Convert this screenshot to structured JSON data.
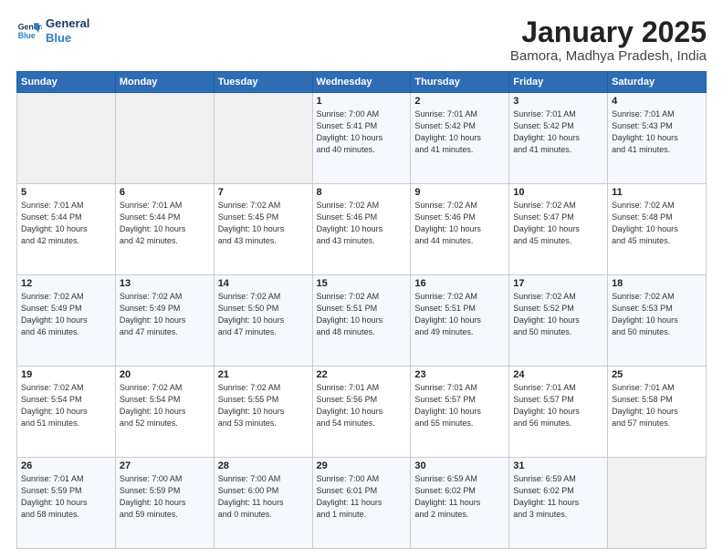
{
  "logo": {
    "line1": "General",
    "line2": "Blue"
  },
  "header": {
    "month": "January 2025",
    "location": "Bamora, Madhya Pradesh, India"
  },
  "weekdays": [
    "Sunday",
    "Monday",
    "Tuesday",
    "Wednesday",
    "Thursday",
    "Friday",
    "Saturday"
  ],
  "weeks": [
    [
      {
        "day": "",
        "info": ""
      },
      {
        "day": "",
        "info": ""
      },
      {
        "day": "",
        "info": ""
      },
      {
        "day": "1",
        "info": "Sunrise: 7:00 AM\nSunset: 5:41 PM\nDaylight: 10 hours\nand 40 minutes."
      },
      {
        "day": "2",
        "info": "Sunrise: 7:01 AM\nSunset: 5:42 PM\nDaylight: 10 hours\nand 41 minutes."
      },
      {
        "day": "3",
        "info": "Sunrise: 7:01 AM\nSunset: 5:42 PM\nDaylight: 10 hours\nand 41 minutes."
      },
      {
        "day": "4",
        "info": "Sunrise: 7:01 AM\nSunset: 5:43 PM\nDaylight: 10 hours\nand 41 minutes."
      }
    ],
    [
      {
        "day": "5",
        "info": "Sunrise: 7:01 AM\nSunset: 5:44 PM\nDaylight: 10 hours\nand 42 minutes."
      },
      {
        "day": "6",
        "info": "Sunrise: 7:01 AM\nSunset: 5:44 PM\nDaylight: 10 hours\nand 42 minutes."
      },
      {
        "day": "7",
        "info": "Sunrise: 7:02 AM\nSunset: 5:45 PM\nDaylight: 10 hours\nand 43 minutes."
      },
      {
        "day": "8",
        "info": "Sunrise: 7:02 AM\nSunset: 5:46 PM\nDaylight: 10 hours\nand 43 minutes."
      },
      {
        "day": "9",
        "info": "Sunrise: 7:02 AM\nSunset: 5:46 PM\nDaylight: 10 hours\nand 44 minutes."
      },
      {
        "day": "10",
        "info": "Sunrise: 7:02 AM\nSunset: 5:47 PM\nDaylight: 10 hours\nand 45 minutes."
      },
      {
        "day": "11",
        "info": "Sunrise: 7:02 AM\nSunset: 5:48 PM\nDaylight: 10 hours\nand 45 minutes."
      }
    ],
    [
      {
        "day": "12",
        "info": "Sunrise: 7:02 AM\nSunset: 5:49 PM\nDaylight: 10 hours\nand 46 minutes."
      },
      {
        "day": "13",
        "info": "Sunrise: 7:02 AM\nSunset: 5:49 PM\nDaylight: 10 hours\nand 47 minutes."
      },
      {
        "day": "14",
        "info": "Sunrise: 7:02 AM\nSunset: 5:50 PM\nDaylight: 10 hours\nand 47 minutes."
      },
      {
        "day": "15",
        "info": "Sunrise: 7:02 AM\nSunset: 5:51 PM\nDaylight: 10 hours\nand 48 minutes."
      },
      {
        "day": "16",
        "info": "Sunrise: 7:02 AM\nSunset: 5:51 PM\nDaylight: 10 hours\nand 49 minutes."
      },
      {
        "day": "17",
        "info": "Sunrise: 7:02 AM\nSunset: 5:52 PM\nDaylight: 10 hours\nand 50 minutes."
      },
      {
        "day": "18",
        "info": "Sunrise: 7:02 AM\nSunset: 5:53 PM\nDaylight: 10 hours\nand 50 minutes."
      }
    ],
    [
      {
        "day": "19",
        "info": "Sunrise: 7:02 AM\nSunset: 5:54 PM\nDaylight: 10 hours\nand 51 minutes."
      },
      {
        "day": "20",
        "info": "Sunrise: 7:02 AM\nSunset: 5:54 PM\nDaylight: 10 hours\nand 52 minutes."
      },
      {
        "day": "21",
        "info": "Sunrise: 7:02 AM\nSunset: 5:55 PM\nDaylight: 10 hours\nand 53 minutes."
      },
      {
        "day": "22",
        "info": "Sunrise: 7:01 AM\nSunset: 5:56 PM\nDaylight: 10 hours\nand 54 minutes."
      },
      {
        "day": "23",
        "info": "Sunrise: 7:01 AM\nSunset: 5:57 PM\nDaylight: 10 hours\nand 55 minutes."
      },
      {
        "day": "24",
        "info": "Sunrise: 7:01 AM\nSunset: 5:57 PM\nDaylight: 10 hours\nand 56 minutes."
      },
      {
        "day": "25",
        "info": "Sunrise: 7:01 AM\nSunset: 5:58 PM\nDaylight: 10 hours\nand 57 minutes."
      }
    ],
    [
      {
        "day": "26",
        "info": "Sunrise: 7:01 AM\nSunset: 5:59 PM\nDaylight: 10 hours\nand 58 minutes."
      },
      {
        "day": "27",
        "info": "Sunrise: 7:00 AM\nSunset: 5:59 PM\nDaylight: 10 hours\nand 59 minutes."
      },
      {
        "day": "28",
        "info": "Sunrise: 7:00 AM\nSunset: 6:00 PM\nDaylight: 11 hours\nand 0 minutes."
      },
      {
        "day": "29",
        "info": "Sunrise: 7:00 AM\nSunset: 6:01 PM\nDaylight: 11 hours\nand 1 minute."
      },
      {
        "day": "30",
        "info": "Sunrise: 6:59 AM\nSunset: 6:02 PM\nDaylight: 11 hours\nand 2 minutes."
      },
      {
        "day": "31",
        "info": "Sunrise: 6:59 AM\nSunset: 6:02 PM\nDaylight: 11 hours\nand 3 minutes."
      },
      {
        "day": "",
        "info": ""
      }
    ]
  ]
}
